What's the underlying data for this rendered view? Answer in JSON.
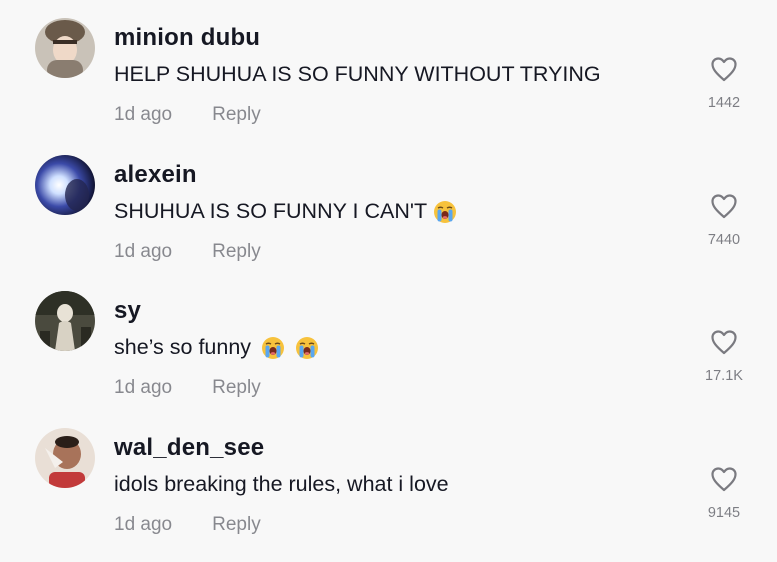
{
  "comments": [
    {
      "username": "minion dubu",
      "text": "HELP SHUHUA IS SO FUNNY WITHOUT TRYING",
      "emojis": [],
      "time": "1d ago",
      "reply": "Reply",
      "likes": "1442",
      "avatar_colors": [
        "#c7b7a6",
        "#6f5a4c"
      ]
    },
    {
      "username": "alexein",
      "text": "SHUHUA IS SO FUNNY I CAN'T",
      "emojis": [
        "loudly-crying-face-emoji"
      ],
      "time": "1d ago",
      "reply": "Reply",
      "likes": "7440",
      "avatar_colors": [
        "#1b1f4a",
        "#dfe8ff"
      ]
    },
    {
      "username": "sy",
      "text": "she’s so funny",
      "emojis": [
        "loudly-crying-face-emoji",
        "loudly-crying-face-emoji"
      ],
      "time": "1d ago",
      "reply": "Reply",
      "likes": "17.1K",
      "avatar_colors": [
        "#3a3a30",
        "#d9d4c8"
      ]
    },
    {
      "username": "wal_den_see",
      "text": "idols breaking the rules, what i love",
      "emojis": [],
      "time": "1d ago",
      "reply": "Reply",
      "likes": "9145",
      "avatar_colors": [
        "#9a6f55",
        "#f2ece6"
      ]
    }
  ],
  "colors": {
    "background": "#f8f8f8",
    "text_primary": "#161823",
    "text_secondary": "rgba(22,24,35,0.5)",
    "emoji_yellow": "#f7c23c",
    "emoji_tears": "#5aa7f0"
  }
}
